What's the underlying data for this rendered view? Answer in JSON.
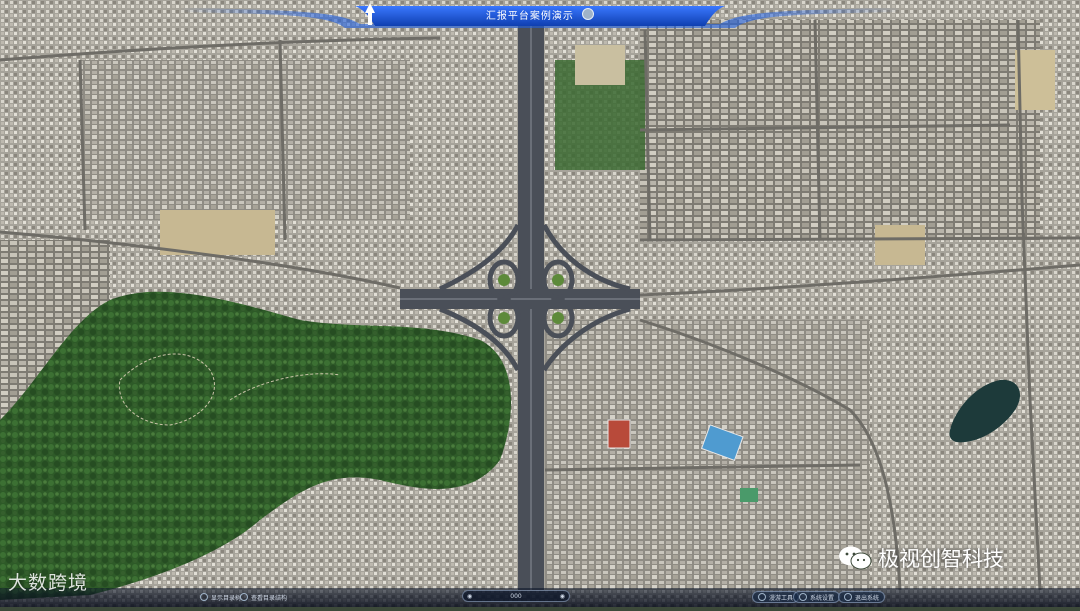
{
  "header": {
    "title": "汇报平台案例演示"
  },
  "bottom_bar": {
    "left_buttons": [
      "显示目录树",
      "查看目录结构"
    ],
    "zoom_value": "000",
    "right_buttons": [
      "漫游工具",
      "系统设置",
      "退出系统"
    ]
  },
  "watermarks": {
    "left_text": "大数跨境",
    "right_text": "极视创智科技"
  },
  "colors": {
    "banner_blue": "#1f5fe0",
    "highway": "#4a4f58",
    "vegetation": "#2f5e2a",
    "urban": "#9a9890"
  }
}
